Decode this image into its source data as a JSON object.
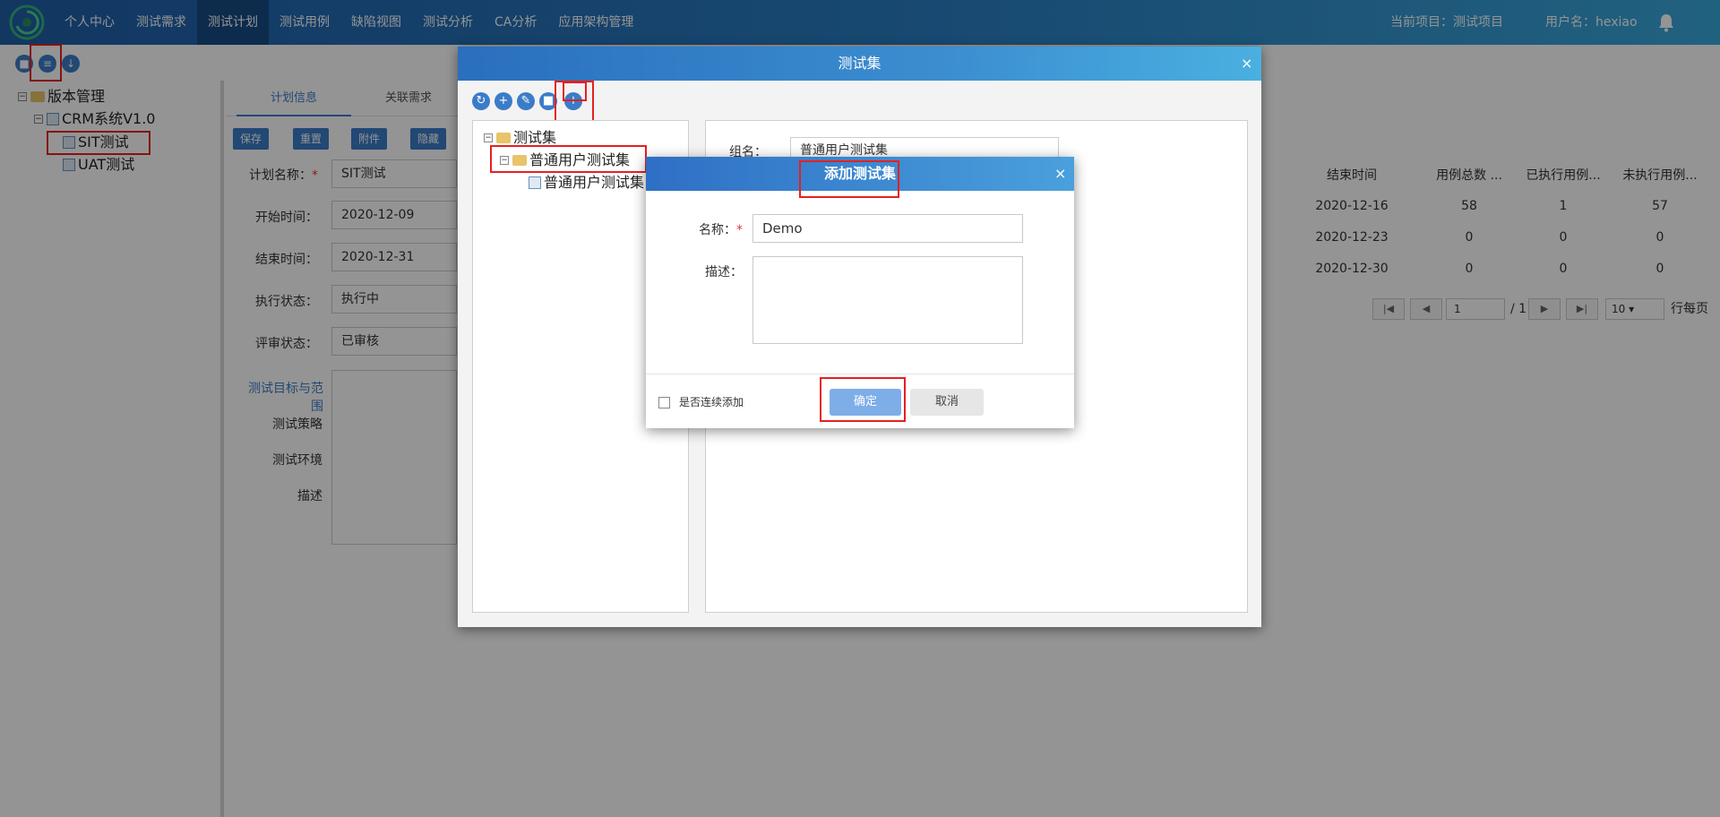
{
  "nav": {
    "menu": [
      "个人中心",
      "测试需求",
      "测试计划",
      "测试用例",
      "缺陷视图",
      "测试分析",
      "CA分析",
      "应用架构管理"
    ],
    "current_project": "当前项目：测试项目",
    "username": "用户名：hexiao"
  },
  "left_tree": {
    "root": "版本管理",
    "version": "CRM系统V1.0",
    "plans": [
      "SIT测试",
      "UAT测试"
    ]
  },
  "plan_tabs": [
    "计划信息",
    "关联需求"
  ],
  "plan_buttons": [
    "保存",
    "重置",
    "附件",
    "隐藏"
  ],
  "plan_form": {
    "name_label": "计划名称：",
    "name_value": "SIT测试",
    "start_label": "开始时间：",
    "start_value": "2020-12-09",
    "end_label": "结束时间：",
    "end_value": "2020-12-31",
    "exec_label": "执行状态：",
    "exec_value": "执行中",
    "review_label": "评审状态：",
    "review_value": "已审核",
    "scope_link": "测试目标与范围",
    "strategy": "测试策略",
    "env": "测试环境",
    "desc": "描述"
  },
  "table": {
    "headers": [
      "结束时间",
      "用例总数 ...",
      "已执行用例...",
      "未执行用例..."
    ],
    "rows": [
      [
        "2020-12-16",
        "58",
        "1",
        "57"
      ],
      [
        "2020-12-23",
        "0",
        "0",
        "0"
      ],
      [
        "2020-12-30",
        "0",
        "0",
        "0"
      ]
    ],
    "pager": {
      "page": "1",
      "total": "/ 1",
      "size": "10",
      "per_page": "行每页"
    }
  },
  "testset_modal": {
    "title": "测试集",
    "close": "×",
    "tree": {
      "root": "测试集",
      "group": "普通用户测试集",
      "leaf": "普通用户测试集"
    },
    "group_label": "组名：",
    "group_value": "普通用户测试集"
  },
  "add_modal": {
    "title": "添加测试集",
    "close": "×",
    "name_label": "名称：",
    "required": "*",
    "name_value": "Demo",
    "desc_label": "描述：",
    "continuous": "是否连续添加",
    "ok": "确定",
    "cancel": "取消"
  },
  "colors": {
    "accent": "#3b7cc8",
    "nav_dark": "#164a86",
    "annotation": "#e62020"
  }
}
